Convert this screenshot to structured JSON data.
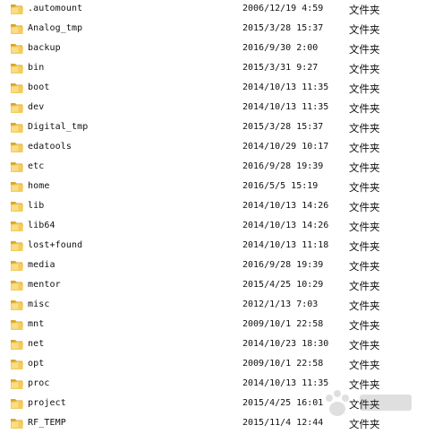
{
  "file_list": {
    "rows": [
      {
        "name": ".automount",
        "modified": "2006/12/19 4:59",
        "type": "文件夹",
        "icon": "folder-icon"
      },
      {
        "name": "Analog_tmp",
        "modified": "2015/3/28 15:37",
        "type": "文件夹",
        "icon": "folder-icon"
      },
      {
        "name": "backup",
        "modified": "2016/9/30 2:00",
        "type": "文件夹",
        "icon": "folder-icon"
      },
      {
        "name": "bin",
        "modified": "2015/3/31 9:27",
        "type": "文件夹",
        "icon": "folder-icon"
      },
      {
        "name": "boot",
        "modified": "2014/10/13 11:35",
        "type": "文件夹",
        "icon": "folder-icon"
      },
      {
        "name": "dev",
        "modified": "2014/10/13 11:35",
        "type": "文件夹",
        "icon": "folder-icon"
      },
      {
        "name": "Digital_tmp",
        "modified": "2015/3/28 15:37",
        "type": "文件夹",
        "icon": "folder-icon"
      },
      {
        "name": "edatools",
        "modified": "2014/10/29 10:17",
        "type": "文件夹",
        "icon": "folder-icon"
      },
      {
        "name": "etc",
        "modified": "2016/9/28 19:39",
        "type": "文件夹",
        "icon": "folder-icon"
      },
      {
        "name": "home",
        "modified": "2016/5/5 15:19",
        "type": "文件夹",
        "icon": "folder-icon"
      },
      {
        "name": "lib",
        "modified": "2014/10/13 14:26",
        "type": "文件夹",
        "icon": "folder-icon"
      },
      {
        "name": "lib64",
        "modified": "2014/10/13 14:26",
        "type": "文件夹",
        "icon": "folder-icon"
      },
      {
        "name": "lost+found",
        "modified": "2014/10/13 11:18",
        "type": "文件夹",
        "icon": "folder-icon"
      },
      {
        "name": "media",
        "modified": "2016/9/28 19:39",
        "type": "文件夹",
        "icon": "folder-icon"
      },
      {
        "name": "mentor",
        "modified": "2015/4/25 10:29",
        "type": "文件夹",
        "icon": "folder-icon"
      },
      {
        "name": "misc",
        "modified": "2012/1/13 7:03",
        "type": "文件夹",
        "icon": "folder-icon"
      },
      {
        "name": "mnt",
        "modified": "2009/10/1 22:58",
        "type": "文件夹",
        "icon": "folder-icon"
      },
      {
        "name": "net",
        "modified": "2014/10/23 18:30",
        "type": "文件夹",
        "icon": "folder-icon"
      },
      {
        "name": "opt",
        "modified": "2009/10/1 22:58",
        "type": "文件夹",
        "icon": "folder-icon"
      },
      {
        "name": "proc",
        "modified": "2014/10/13 11:35",
        "type": "文件夹",
        "icon": "folder-icon"
      },
      {
        "name": "project",
        "modified": "2015/4/25 16:01",
        "type": "文件夹",
        "icon": "folder-icon"
      },
      {
        "name": "RF_TEMP",
        "modified": "2015/11/4 12:44",
        "type": "文件夹",
        "icon": "folder-icon"
      }
    ]
  },
  "colors": {
    "folder_back": "#d9a52a",
    "folder_front": "#f4cc5c",
    "folder_highlight": "#fbe49a",
    "text": "#111111",
    "background": "#ffffff"
  }
}
